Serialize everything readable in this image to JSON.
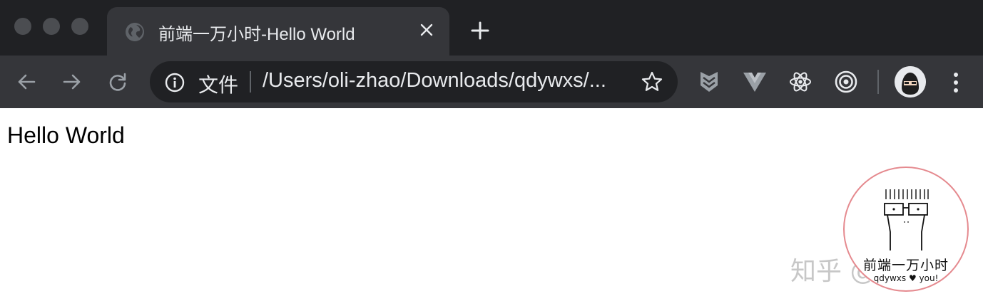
{
  "window": {
    "tab": {
      "title": "前端一万小时-Hello World"
    }
  },
  "toolbar": {
    "address": {
      "scheme_label": "文件",
      "url": "/Users/oli-zhao/Downloads/qdywxs/..."
    }
  },
  "page": {
    "body_text": "Hello World"
  },
  "watermark": {
    "platform": "知乎",
    "handle": "@itsOli",
    "stamp_title": "前端一万小时",
    "stamp_sub": "qdywxs ♥ you!"
  },
  "colors": {
    "titlebar_bg": "#202124",
    "toolbar_bg": "#35363a",
    "omnibox_bg": "#202124",
    "text_light": "#e8eaed",
    "icon_gray": "#9aa0a6",
    "stamp_ring": "#e58a8f"
  },
  "icons": {
    "favicon": "globe-icon",
    "close": "close-icon",
    "new_tab": "plus-icon",
    "back": "arrow-left-icon",
    "forward": "arrow-right-icon",
    "reload": "reload-icon",
    "info": "info-icon",
    "bookmark": "star-icon",
    "extensions": [
      "sourcetree-icon",
      "vue-devtools-icon",
      "react-devtools-icon",
      "target-icon"
    ],
    "menu": "kebab-menu-icon"
  }
}
